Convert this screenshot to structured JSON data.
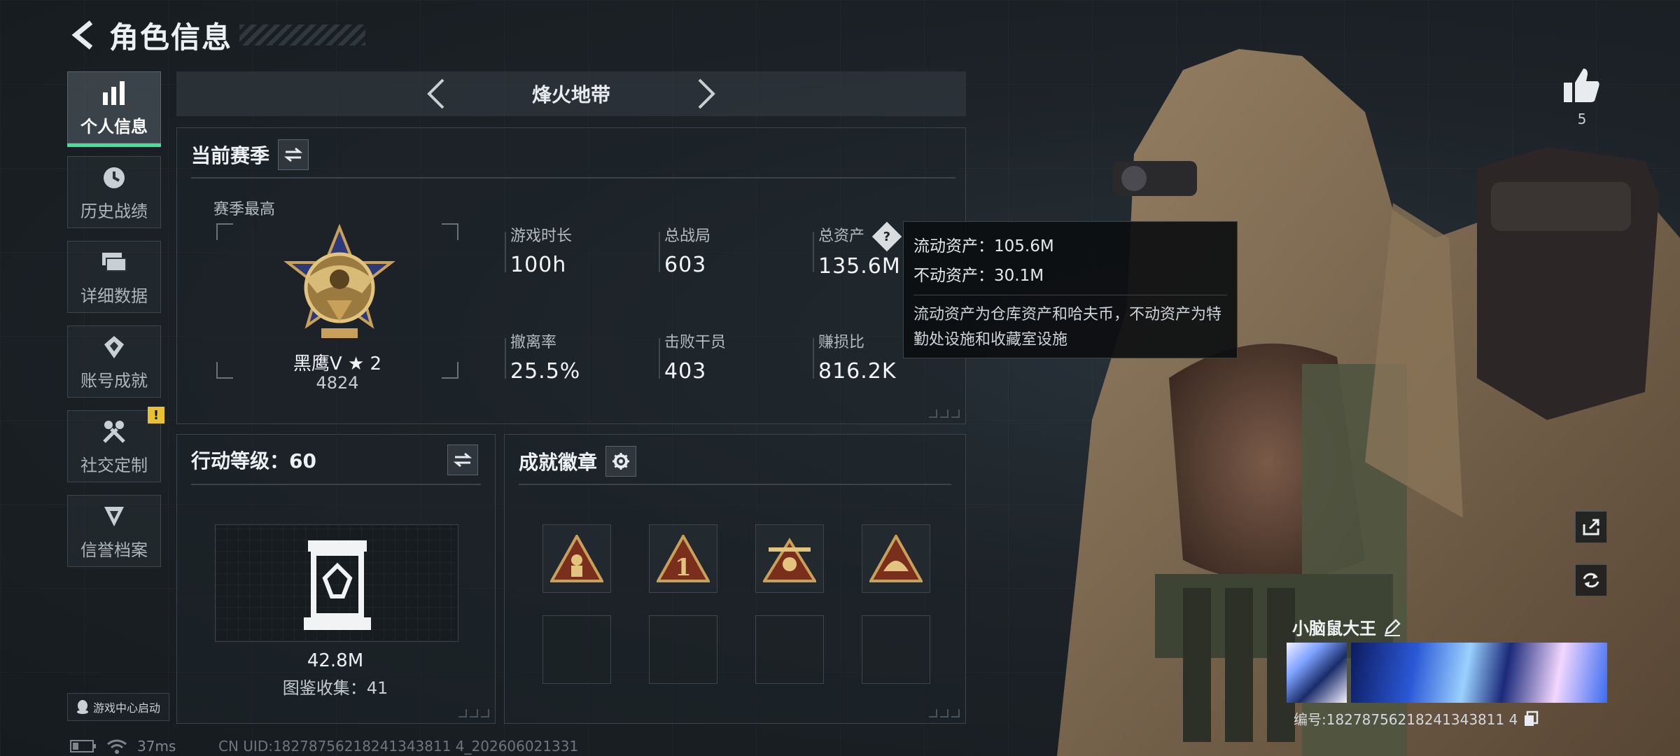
{
  "header": {
    "title": "角色信息"
  },
  "sidebar": {
    "items": [
      {
        "label": "个人信息",
        "icon": "bar-chart-icon",
        "active": true
      },
      {
        "label": "历史战绩",
        "icon": "history-icon",
        "active": false
      },
      {
        "label": "详细数据",
        "icon": "cards-icon",
        "active": false
      },
      {
        "label": "账号成就",
        "icon": "achievement-icon",
        "active": false
      },
      {
        "label": "社交定制",
        "icon": "tools-icon",
        "active": false,
        "badge": "!"
      },
      {
        "label": "信誉档案",
        "icon": "credit-icon",
        "active": false
      }
    ]
  },
  "mode_bar": {
    "mode": "烽火地带"
  },
  "season": {
    "title": "当前赛季",
    "subtitle": "赛季最高",
    "rank_name": "黑鹰Ⅴ ★ 2",
    "rank_score": "4824",
    "stats": [
      {
        "label": "游戏时长",
        "value": "100h"
      },
      {
        "label": "总战局",
        "value": "603"
      },
      {
        "label": "总资产",
        "value": "135.6M"
      },
      {
        "label": "撤离率",
        "value": "25.5%"
      },
      {
        "label": "击败干员",
        "value": "403"
      },
      {
        "label": "赚损比",
        "value": "816.2K"
      }
    ]
  },
  "tooltip": {
    "liquid": "流动资产：105.6M",
    "fixed": "不动资产：30.1M",
    "desc": "流动资产为仓库资产和哈夫币，不动资产为特勤处设施和收藏室设施"
  },
  "level": {
    "title": "行动等级：60",
    "collect_value": "42.8M",
    "collect_count": "图鉴收集：41"
  },
  "badges": {
    "title": "成就徽章",
    "items": [
      "soldier-badge-icon",
      "number-one-badge-icon",
      "plane-badge-icon",
      "helmet-badge-icon",
      "",
      "",
      "",
      ""
    ]
  },
  "footer": {
    "game_center": "游戏中心启动",
    "ping": "37ms",
    "uid": "CN UID:18278756218241343811 4_202606021331"
  },
  "profile": {
    "likes": "5",
    "player_name": "小脑鼠大王",
    "player_id": "编号:18278756218241343811 4"
  },
  "colors": {
    "accent": "#3fe39a",
    "badge_gold": "#c9a05a",
    "warning": "#e8c230"
  }
}
